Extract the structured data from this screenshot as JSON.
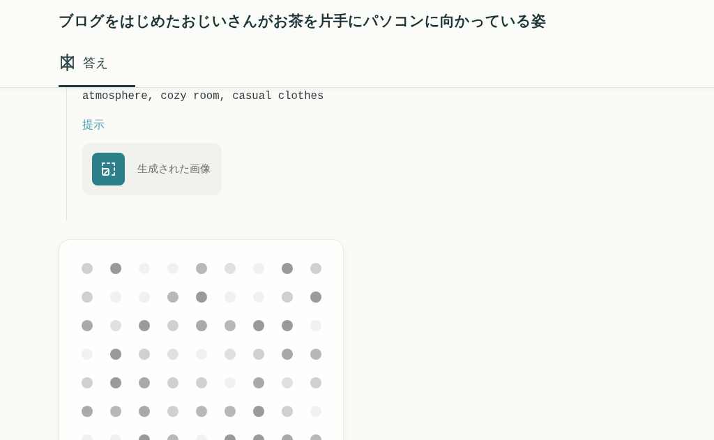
{
  "header": {
    "title": "ブログをはじめたおじいさんがお茶を片手にパソコンに向かっている姿",
    "tabs": [
      {
        "label": "答え",
        "selected": true
      }
    ]
  },
  "answer": {
    "prompt_text": "atmosphere, cozy room, casual clothes",
    "hint_link": "提示",
    "generated_image": {
      "label": "生成された画像"
    }
  }
}
